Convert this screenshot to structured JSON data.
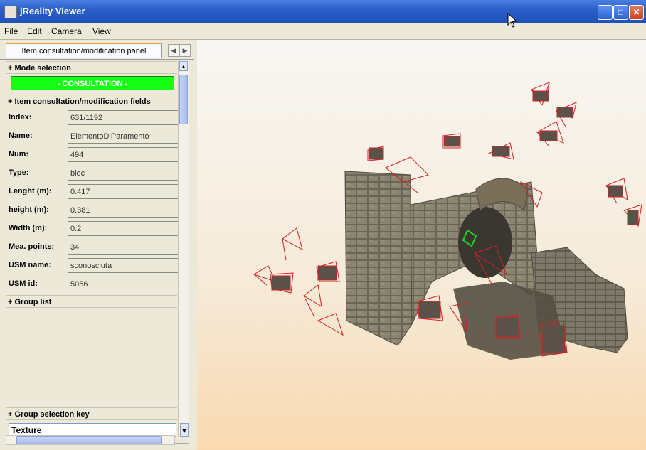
{
  "window": {
    "title": "jReality Viewer"
  },
  "menu": [
    "File",
    "Edit",
    "Camera",
    "View"
  ],
  "tab": {
    "label": "Item consultation/modification panel"
  },
  "sections": {
    "mode": "+ Mode selection",
    "fields": "+ Item consultation/modification fields",
    "group_list": "+ Group list",
    "group_key": "+ Group selection key"
  },
  "mode_value": "- CONSULTATION -",
  "fields": [
    {
      "label": "Index:",
      "value": "631/1192"
    },
    {
      "label": "Name:",
      "value": "ElementoDiParamento"
    },
    {
      "label": "Num:",
      "value": "494"
    },
    {
      "label": "Type:",
      "value": "bloc"
    },
    {
      "label": "Lenght (m):",
      "value": "0.417"
    },
    {
      "label": "height (m):",
      "value": "0.381"
    },
    {
      "label": "Width (m):",
      "value": "0.2"
    },
    {
      "label": "Mea. points:",
      "value": "34"
    },
    {
      "label": "USM name:",
      "value": "sconosciuta"
    },
    {
      "label": "USM id:",
      "value": "5056"
    }
  ],
  "group_key_value": "Texture",
  "colors": {
    "mode_bg": "#14ff14",
    "titlebar": "#2a5fc9",
    "camera": "#d42020"
  }
}
